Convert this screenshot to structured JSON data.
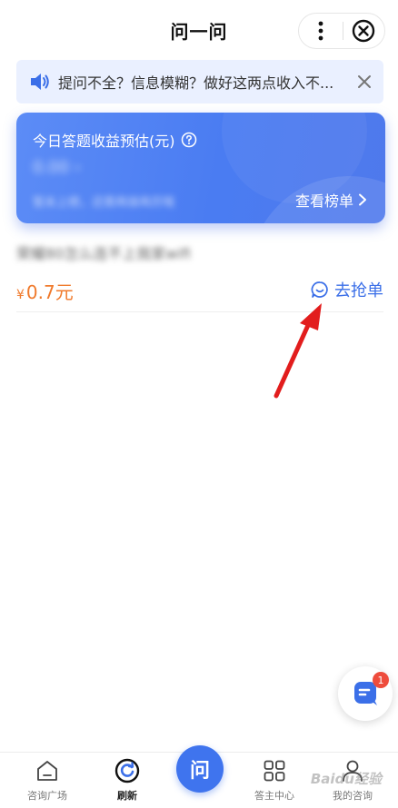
{
  "header": {
    "title": "问一问",
    "more_icon": "more-vertical-icon",
    "close_icon": "close-circle-icon"
  },
  "notice": {
    "icon": "speaker-icon",
    "text": "提问不全？信息模糊？做好这两点收入不...",
    "close_icon": "close-icon"
  },
  "earnings_card": {
    "label": "今日答题收益预估(元)",
    "help_icon": "question-circle-icon",
    "amount": "0.00 ›",
    "subtitle": "暂未上榜，还需再接再厉哦",
    "rank_link": "查看榜单",
    "accent": "#4a7cf2"
  },
  "question": {
    "title": "荣耀80怎么连不上我家wifi",
    "currency": "¥",
    "price": "0.7元",
    "grab_label": "去抢单",
    "price_color": "#f07a2c",
    "link_color": "#3b6fe8"
  },
  "floating": {
    "icon": "chat-bubble-icon",
    "badge": "1"
  },
  "bottom_nav": {
    "items": [
      {
        "label": "咨询广场",
        "icon": "home-icon"
      },
      {
        "label": "刷新",
        "icon": "refresh-icon"
      },
      {
        "label": "问",
        "icon": "ask-icon"
      },
      {
        "label": "答主中心",
        "icon": "grid-icon"
      },
      {
        "label": "我的咨询",
        "icon": "user-icon"
      }
    ]
  },
  "watermark": "Baidu经验"
}
